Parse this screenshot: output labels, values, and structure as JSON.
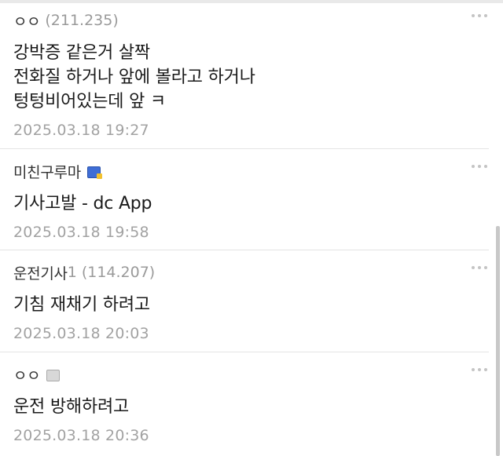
{
  "comments": [
    {
      "nick": "ㅇㅇ",
      "nick_suffix": "",
      "ip": "(211.235)",
      "lines": [
        "강박증 같은거 살짝",
        "전화질 하거나 앞에 볼라고 하거나",
        "텅텅비어있는데 앞 ㅋ"
      ],
      "date": "2025.03.18 19:27",
      "badge": "none"
    },
    {
      "nick": "미친구루마",
      "nick_suffix": "",
      "ip": "",
      "lines": [
        "기사고발 - dc App"
      ],
      "date": "2025.03.18 19:58",
      "badge": "blue-fixed-nick-icon"
    },
    {
      "nick": "운전기사",
      "nick_suffix": "1",
      "ip": "(114.207)",
      "lines": [
        "기침 재채기 하려고"
      ],
      "date": "2025.03.18 20:03",
      "badge": "none"
    },
    {
      "nick": "ㅇㅇ",
      "nick_suffix": "",
      "ip": "",
      "lines": [
        "운전 방해하려고"
      ],
      "date": "2025.03.18 20:36",
      "badge": "gray-half-fixed-nick-icon"
    }
  ],
  "colors": {
    "text": "#1a1a1a",
    "meta": "#9a9a9a",
    "divider": "#e4e4e4",
    "badge_blue": "#3f6ed6"
  }
}
